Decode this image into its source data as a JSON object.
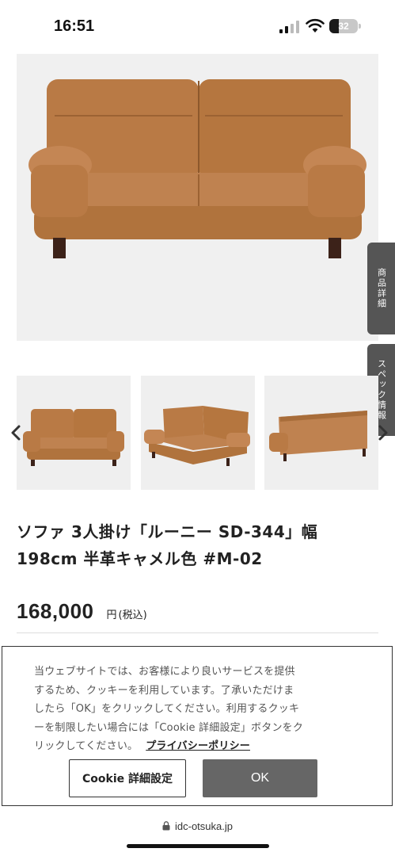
{
  "status_bar": {
    "time": "16:51",
    "battery_level": "32",
    "battery_fraction": 0.32
  },
  "main_image": {
    "icon": "sofa-front-photo"
  },
  "side_tabs": {
    "details": "商品詳細",
    "spec": "スペック情報"
  },
  "thumbnails": [
    {
      "icon": "sofa-front-thumbnail"
    },
    {
      "icon": "sofa-angled-thumbnail"
    },
    {
      "icon": "sofa-back-thumbnail"
    }
  ],
  "product": {
    "title_line1": "ソファ 3人掛け「ルーニー SD-344」幅",
    "title_line2": "198cm 半革キャメル色 #M-02",
    "price": "168,000",
    "currency": "円",
    "tax_note": "(税込)"
  },
  "cookie": {
    "line1": "当ウェブサイトでは、お客様により良いサービスを提供",
    "line2": "するため、クッキーを利用しています。了承いただけま",
    "line3": "したら「OK」をクリックしてください。利用するクッキ",
    "line4": "ーを制限したい場合には「Cookie 詳細設定」ボタンをク",
    "line5": "リックしてください。",
    "privacy_link": "プライバシーポリシー",
    "settings_button": "Cookie 詳細設定",
    "ok_button": "OK"
  },
  "url_bar": {
    "domain": "idc-otsuka.jp"
  },
  "colors": {
    "leather": "#b97a45",
    "leather_dark": "#9c6233",
    "tab_bg": "#555555",
    "ok_bg": "#666666"
  }
}
